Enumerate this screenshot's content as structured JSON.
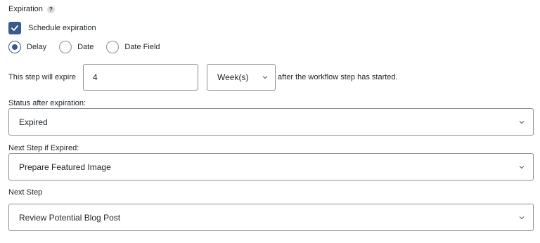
{
  "expiration": {
    "heading": "Expiration",
    "help_glyph": "?",
    "schedule_label": "Schedule expiration",
    "schedule_checked": true
  },
  "radios": [
    {
      "label": "Delay",
      "checked": true
    },
    {
      "label": "Date",
      "checked": false
    },
    {
      "label": "Date Field",
      "checked": false
    }
  ],
  "expire_row": {
    "prefix": "This step will expire",
    "amount": "4",
    "unit": "Week(s)",
    "suffix": "after the workflow step has started."
  },
  "status_after": {
    "label": "Status after expiration:",
    "value": "Expired"
  },
  "next_if_expired": {
    "label": "Next Step if Expired:",
    "value": "Prepare Featured Image"
  },
  "next_step": {
    "label": "Next Step",
    "value": "Review Potential Blog Post"
  },
  "colors": {
    "accent": "#3a5a8a",
    "border": "#8c8f94",
    "text": "#1d2327"
  },
  "icons": {
    "help": "help-icon",
    "check": "checkmark-icon",
    "dropdown": "chevron-down-icon"
  }
}
